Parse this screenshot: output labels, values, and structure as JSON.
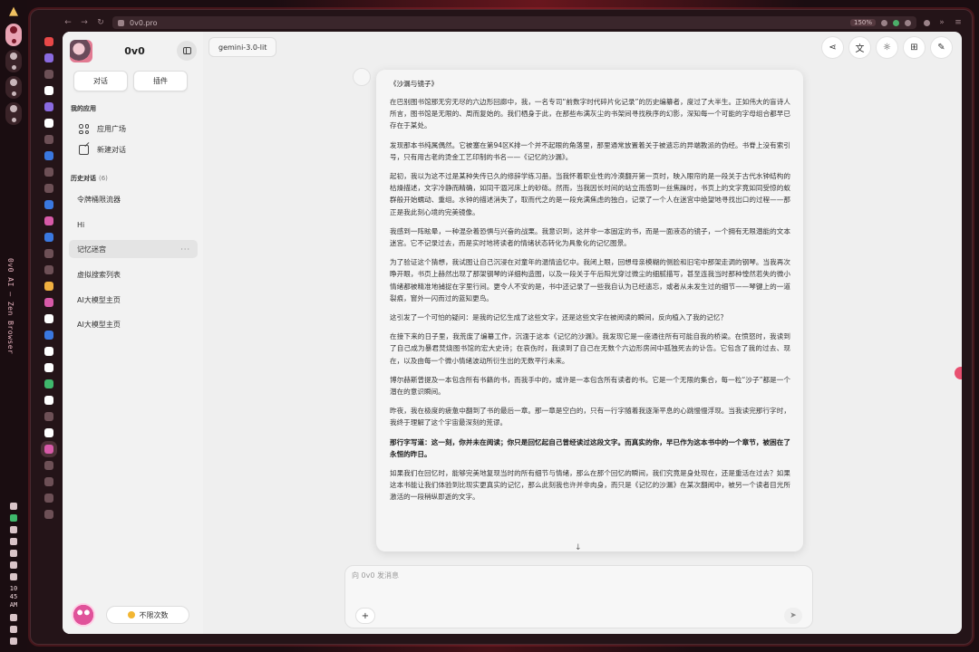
{
  "browser": {
    "url": "0v0.pro",
    "zoom": "150%",
    "vertical_title": "0v0 AI — Zen Browser"
  },
  "os": {
    "clock_hour": "10",
    "clock_minute": "45",
    "clock_period": "AM"
  },
  "sidebar": {
    "app_name": "0v0",
    "tabs": [
      {
        "label": "对话"
      },
      {
        "label": "插件"
      }
    ],
    "my_apps_title": "我的应用",
    "apps": [
      {
        "label": "应用广场"
      },
      {
        "label": "新建对话"
      }
    ],
    "history_title": "历史对话",
    "history_count": "(6)",
    "history": [
      {
        "label": "令牌桶限流器"
      },
      {
        "label": "Hi"
      },
      {
        "label": "记忆迷宫",
        "more": "···"
      },
      {
        "label": "虚拟搜索列表"
      },
      {
        "label": "AI大模型主页"
      },
      {
        "label": "AI大模型主页"
      }
    ],
    "quota_label": "不限次数"
  },
  "header": {
    "model": "gemini-3.0-lit"
  },
  "message": {
    "title": "《沙漏与镜子》",
    "paragraphs": [
      "在巴别图书馆那无穷无尽的六边形回廊中，我，一名专司“前数字时代碎片化记录”的历史编纂者，度过了大半生。正如伟大的盲诗人所言，图书馆是无限的、周而复始的。我们栖身于此，在那些布满灰尘的书架间寻找秩序的幻影，深知每一个可能的字母组合都早已存在于某处。",
      "发现那本书纯属偶然。它被塞在第94区K排一个并不起眼的角落里，那里通常放置着关于被遗忘的异端教派的伪经。书脊上没有索引号，只有用古老的烫金工艺印制的书名——《记忆的沙漏》。",
      "起初，我以为这不过是某种失传已久的修辞学练习册。当我怀着职业性的冷漠翻开第一页时，映入眼帘的是一段关于古代水钟结构的枯燥描述，文字冷静而精确，如同干涸河床上的砂砾。然而，当我因长时间的站立而感到一丝焦躁时，书页上的文字竟如同受惊的蚁群般开始蠕动、重组。水钟的描述消失了，取而代之的是一段充满焦虑的独白，记录了一个人在迷宫中绝望地寻找出口的过程——那正是我此刻心境的完美镜像。",
      "我感到一阵眩晕，一种混杂着恐惧与兴奋的战栗。我意识到，这并非一本固定的书，而是一面液态的镜子，一个拥有无限潜能的文本迷宫。它不记录过去，而是实时地将读者的情绪状态转化为具象化的记忆图景。",
      "为了验证这个猜想，我试图让自己沉浸在对童年的温情追忆中。我闭上眼，回想母亲模糊的侧脸和旧宅中那架走调的钢琴。当我再次睁开眼，书页上赫然出现了那架钢琴的详细构造图，以及一段关于午后阳光穿过微尘的细腻描写，甚至连我当时那种惶然若失的微小情绪都被精准地捕捉在字里行间。更令人不安的是，书中还记录了一些我自认为已经遗忘，或者从未发生过的细节——琴键上的一道裂痕，窗外一闪而过的蓝知更鸟。",
      "这引发了一个可怕的疑问：是我的记忆生成了这些文字，还是这些文字在被阅读的瞬间，反向植入了我的记忆？",
      "在接下来的日子里，我荒废了编纂工作，沉湎于这本《记忆的沙漏》。我发现它是一座通往所有可能自我的桥梁。在愤怒时，我读到了自己成为暴君焚烧图书馆的宏大史诗；在哀伤时，我读到了自己在无数个六边形房间中孤独死去的讣告。它包含了我的过去、现在，以及由每一个微小情绪波动所衍生出的无数平行未来。",
      "博尔赫斯曾提及一本包含所有书籍的书，而我手中的，或许是一本包含所有读者的书。它是一个无限的集合，每一粒“沙子”都是一个潜在的意识瞬间。",
      "昨夜，我在极度的疲惫中翻到了书的最后一章。那一章是空白的，只有一行字随着我逐渐平息的心跳慢慢浮现。当我读完那行字时，我终于理解了这个宇宙最深刻的荒谬。",
      "那行字写道：这一刻，你并未在阅读；你只是回忆起自己曾经读过这段文字。而真实的你，早已作为这本书中的一个章节，被困在了永恒的昨日。",
      "如果我们在回忆时，能够完美地复现当时的所有细节与情绪，那么在那个回忆的瞬间，我们究竟是身处现在，还是重活在过去？如果这本书能让我们体验到比现实更真实的记忆，那么此刻我也许并非肉身，而只是《记忆的沙漏》在某次翻阅中，被另一个读者目光所激活的一段稍纵即逝的文字。"
    ],
    "bold_paragraph_index": 9,
    "scroll_glyph": "↓"
  },
  "composer": {
    "placeholder": "向 0v0 发消息",
    "plus_glyph": "+",
    "send_glyph": "➤"
  },
  "icons": {
    "share": "share-icon",
    "translate": "translate-icon",
    "theme": "sun-icon",
    "grid": "grid-icon",
    "edit": "edit-icon"
  }
}
